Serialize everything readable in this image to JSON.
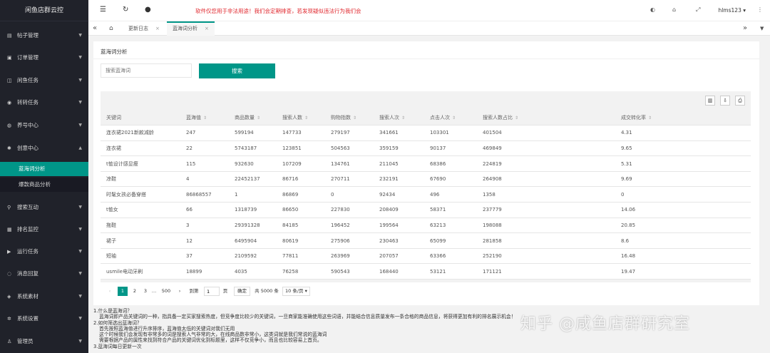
{
  "app": {
    "title": "闲鱼店群云控"
  },
  "sidebar": {
    "items": [
      {
        "label": "帖子管理",
        "icon": "document-icon"
      },
      {
        "label": "订单管理",
        "icon": "clipboard-icon"
      },
      {
        "label": "闲鱼任务",
        "icon": "fish-icon"
      },
      {
        "label": "转转任务",
        "icon": "refresh-circle-icon"
      },
      {
        "label": "养号中心",
        "icon": "user-circle-icon"
      },
      {
        "label": "创意中心",
        "icon": "gear-icon"
      }
    ],
    "sub_items": [
      {
        "label": "蓝海词分析"
      },
      {
        "label": "爆款商品分析"
      }
    ],
    "items_after": [
      {
        "label": "搜索互动",
        "icon": "search-icon"
      },
      {
        "label": "排名监控",
        "icon": "monitor-icon"
      },
      {
        "label": "运行任务",
        "icon": "play-icon"
      },
      {
        "label": "消息回复",
        "icon": "message-icon"
      },
      {
        "label": "系统素材",
        "icon": "cube-icon"
      },
      {
        "label": "系统设置",
        "icon": "settings-icon"
      },
      {
        "label": "管理员",
        "icon": "admin-icon"
      }
    ]
  },
  "header": {
    "notice": "软件仅您用于非法用途！我们会定期排查，若发现疑似违法行为我们会",
    "username": "hlms123"
  },
  "tabs": [
    {
      "label": "更新日志"
    },
    {
      "label": "蓝海词分析"
    }
  ],
  "card": {
    "title": "蓝海词分析",
    "search_placeholder": "搜索蓝海词",
    "search_button": "搜索"
  },
  "table": {
    "columns": [
      "关键词",
      "蓝海值",
      "商品数量",
      "搜索人数",
      "购物指数",
      "搜索人次",
      "点击人次",
      "搜索人数占比",
      "成交转化率"
    ],
    "rows": [
      [
        "连衣裙2021新款减龄",
        "247",
        "599194",
        "147733",
        "279197",
        "341661",
        "103301",
        "401504",
        "4.31"
      ],
      [
        "连衣裙",
        "22",
        "5743187",
        "123851",
        "504563",
        "359159",
        "90137",
        "469849",
        "9.65"
      ],
      [
        "t恤设计感显瘦",
        "115",
        "932630",
        "107209",
        "134761",
        "211045",
        "68386",
        "224819",
        "5.31"
      ],
      [
        "凉鞋",
        "4",
        "22452137",
        "86716",
        "270711",
        "232191",
        "67690",
        "264908",
        "9.69"
      ],
      [
        "时髦女孩必备穿搭",
        "86868557",
        "1",
        "86869",
        "0",
        "92434",
        "496",
        "1358",
        "0"
      ],
      [
        "t恤女",
        "66",
        "1318739",
        "86650",
        "227830",
        "208409",
        "58371",
        "237779",
        "14.06"
      ],
      [
        "拖鞋",
        "3",
        "29391328",
        "84185",
        "196452",
        "199564",
        "63213",
        "198088",
        "20.85"
      ],
      [
        "裙子",
        "12",
        "6495904",
        "80619",
        "275906",
        "230463",
        "65099",
        "281858",
        "8.6"
      ],
      [
        "短袖",
        "37",
        "2109592",
        "77811",
        "263969",
        "207057",
        "63366",
        "252190",
        "16.48"
      ],
      [
        "usmile电动牙刷",
        "18899",
        "4035",
        "76258",
        "590543",
        "168440",
        "53121",
        "171121",
        "19.47"
      ]
    ]
  },
  "pagination": {
    "pages": [
      "1",
      "2",
      "3",
      "…",
      "500"
    ],
    "goto_label": "到第",
    "goto_value": "1",
    "page_unit": "页",
    "confirm": "确定",
    "total": "共 5000 条",
    "page_size": "10 条/页"
  },
  "notes": [
    "1.什么是蓝海词？",
    "蓝海词即产品关键词的一种，指具备一定买家搜索热度，但竞争度比较少的关键词，一旦商家能准确使用这些词语，并能结合信息质量发布一条合格的商品信息，将获得更加有利的排名展示机会！",
    "2.如何筛选出蓝海词？",
    "首先按照蓝海值进行升序排序，蓝海值太低的关键词对我们无用",
    "这个时候我们会发现有非常多的词是搜索人气非常的大，在线商品数非常小，这类词就是我们常说的蓝海词",
    "需要根据产品的属性来找到符合产品的关键词优化到标题里，这样不仅竞争小，而且也比较容易上首页。",
    "3.蓝海词每日更新一次"
  ],
  "watermark": "知乎 @咸鱼店群研究室"
}
